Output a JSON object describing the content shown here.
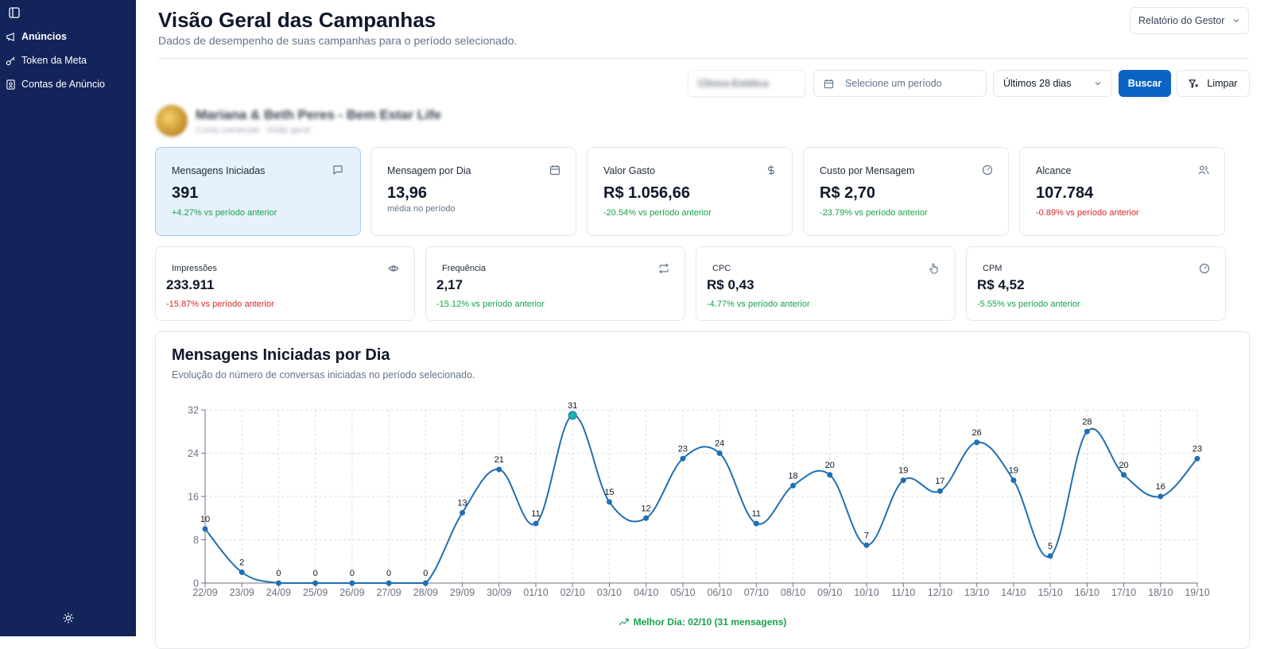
{
  "sidebar": {
    "items": [
      {
        "label": "Anúncios",
        "icon": "megaphone-icon"
      },
      {
        "label": "Token da Meta",
        "icon": "key-icon"
      },
      {
        "label": "Contas de Anúncio",
        "icon": "contact-icon"
      }
    ]
  },
  "header": {
    "title": "Visão Geral das Campanhas",
    "subtitle": "Dados de desempenho de suas campanhas para o período selecionado.",
    "report_select": "Relatório do Gestor"
  },
  "filters": {
    "account": "Clínica Estética",
    "period_placeholder": "Selecione um período",
    "range": "Últimos 28 dias",
    "search_label": "Buscar",
    "clear_label": "Limpar"
  },
  "profile": {
    "name": "Mariana & Beth Peres - Bem Estar Life",
    "subtitle": "Conta comercial · Visão geral"
  },
  "kpis_top": [
    {
      "label": "Mensagens Iniciadas",
      "value": "391",
      "delta": "+4.27% vs período anterior",
      "trend": "pos",
      "icon": "message-icon",
      "active": true
    },
    {
      "label": "Mensagem por Dia",
      "value": "13,96",
      "delta": "média no período",
      "trend": "muted",
      "icon": "calendar-icon",
      "active": false
    },
    {
      "label": "Valor Gasto",
      "value": "R$ 1.056,66",
      "delta": "-20.54% vs período anterior",
      "trend": "pos",
      "icon": "dollar-icon",
      "active": false
    },
    {
      "label": "Custo por Mensagem",
      "value": "R$ 2,70",
      "delta": "-23.79% vs período anterior",
      "trend": "pos",
      "icon": "gauge-icon",
      "active": false
    },
    {
      "label": "Alcance",
      "value": "107.784",
      "delta": "-0.89% vs período anterior",
      "trend": "neg",
      "icon": "users-icon",
      "active": false
    }
  ],
  "kpis_bottom": [
    {
      "label": "Impressões",
      "value": "233.911",
      "delta": "-15.87% vs período anterior",
      "trend": "neg",
      "icon": "eye-icon"
    },
    {
      "label": "Frequência",
      "value": "2,17",
      "delta": "-15.12% vs período anterior",
      "trend": "pos",
      "icon": "repeat-icon"
    },
    {
      "label": "CPC",
      "value": "R$ 0,43",
      "delta": "-4.77% vs período anterior",
      "trend": "pos",
      "icon": "pointer-icon"
    },
    {
      "label": "CPM",
      "value": "R$ 4,52",
      "delta": "-5.55% vs período anterior",
      "trend": "pos",
      "icon": "gauge-icon"
    }
  ],
  "chart_section": {
    "title": "Mensagens Iniciadas por Dia",
    "subtitle": "Evolução do número de conversas iniciadas no período selecionado.",
    "best_day": "Melhor Dia: 02/10 (31 mensagens)"
  },
  "chart_data": {
    "type": "line",
    "x": [
      "22/09",
      "23/09",
      "24/09",
      "25/09",
      "26/09",
      "27/09",
      "28/09",
      "29/09",
      "30/09",
      "01/10",
      "02/10",
      "03/10",
      "04/10",
      "05/10",
      "06/10",
      "07/10",
      "08/10",
      "09/10",
      "10/10",
      "11/10",
      "12/10",
      "13/10",
      "14/10",
      "15/10",
      "16/10",
      "17/10",
      "18/10",
      "19/10"
    ],
    "series": [
      {
        "values": [
          10,
          2,
          0,
          0,
          0,
          0,
          0,
          13,
          21,
          11,
          31,
          15,
          12,
          23,
          24,
          11,
          18,
          20,
          7,
          19,
          17,
          26,
          19,
          5,
          28,
          20,
          16,
          23
        ]
      }
    ],
    "yticks": [
      0,
      8,
      16,
      24,
      32
    ],
    "ylim": [
      0,
      32
    ],
    "grid": true,
    "highlight_index": 10,
    "line_color": "#1f6fb2",
    "highlight_color": "#14b8a6"
  }
}
